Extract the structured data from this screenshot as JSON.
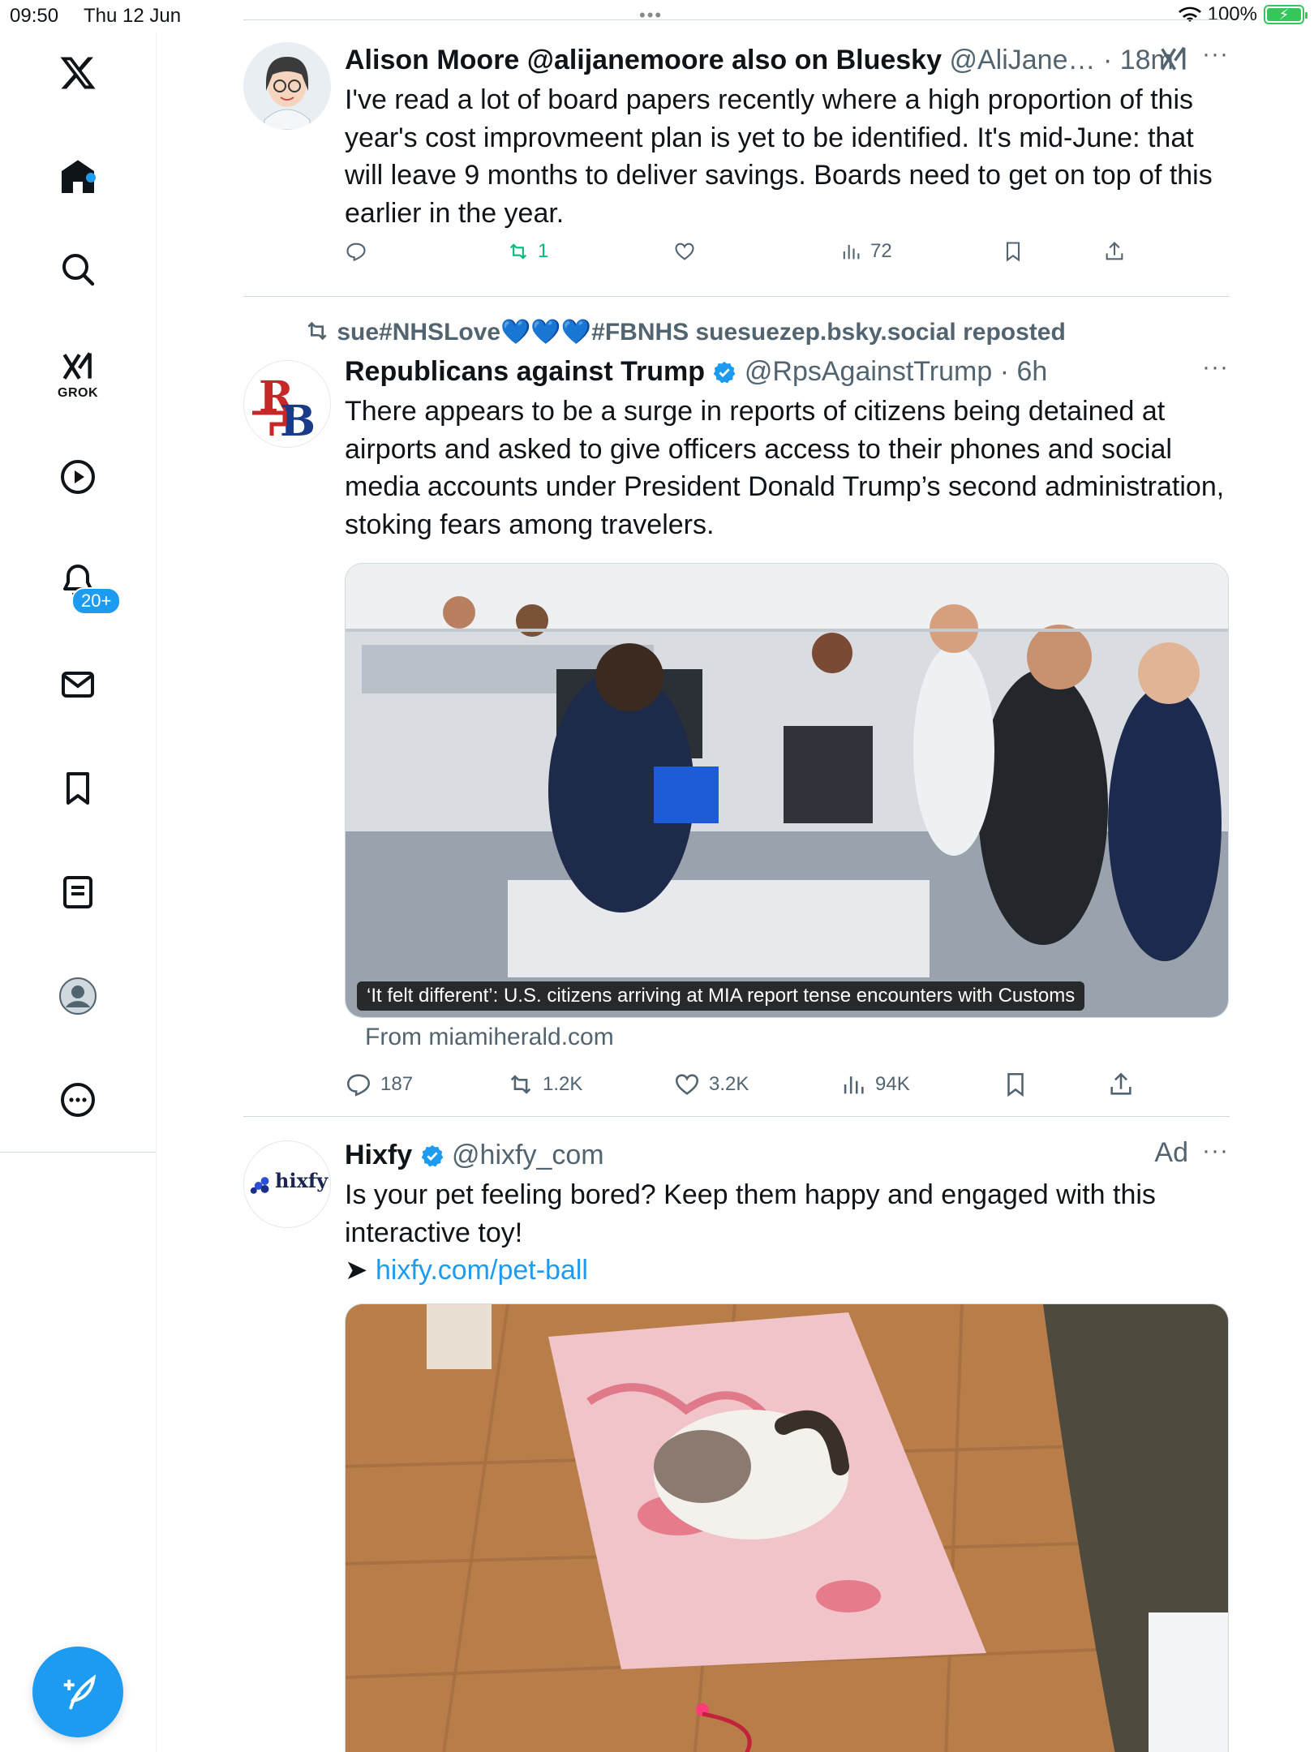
{
  "status": {
    "time": "09:50",
    "date": "Thu 12 Jun",
    "dots": "•••",
    "battery": "100%"
  },
  "sidebar": {
    "items": [
      {
        "name": "x-logo",
        "label": "𝕏"
      },
      {
        "name": "home"
      },
      {
        "name": "explore"
      },
      {
        "name": "grok",
        "label": "GROK"
      },
      {
        "name": "video"
      },
      {
        "name": "notifications",
        "badge": "20+"
      },
      {
        "name": "messages"
      },
      {
        "name": "bookmarks"
      },
      {
        "name": "lists"
      },
      {
        "name": "profile"
      },
      {
        "name": "more"
      }
    ]
  },
  "tweets": [
    {
      "name": "Alison Moore @alijanemoore also on Bluesky",
      "handle": "@AliJane…",
      "time": "· 18m",
      "text": "I've read a lot of board papers recently where a high proportion of this year's cost improvmeent plan is yet to be identified. It's mid-June:  that will leave 9 months to deliver savings.  Boards need to get on top of this earlier in the year.",
      "retweets": "1",
      "views": "72"
    },
    {
      "repost_by": "sue#NHSLove💙💙💙#FBNHS suesuezep.bsky.social reposted",
      "name": "Republicans against Trump",
      "handle": "@RpsAgainstTrump",
      "time": "· 6h",
      "text": "There appears to be a surge in reports of citizens being detained at airports and asked to give officers access to their phones and social media accounts under President Donald Trump’s second administration, stoking fears among travelers.",
      "caption": "‘It felt different’: U.S. citizens arriving at MIA report tense encounters with Customs",
      "source": "From miamiherald.com",
      "replies": "187",
      "retweets": "1.2K",
      "likes": "3.2K",
      "views": "94K"
    },
    {
      "name": "Hixfy",
      "handle": "@hixfy_com",
      "ad": "Ad",
      "text": "Is your pet feeling bored? Keep them happy and engaged with this interactive toy!",
      "arrow": "➤ ",
      "link": "hixfy.com/pet-ball",
      "logo": "hixfy"
    }
  ],
  "more_label": "···"
}
